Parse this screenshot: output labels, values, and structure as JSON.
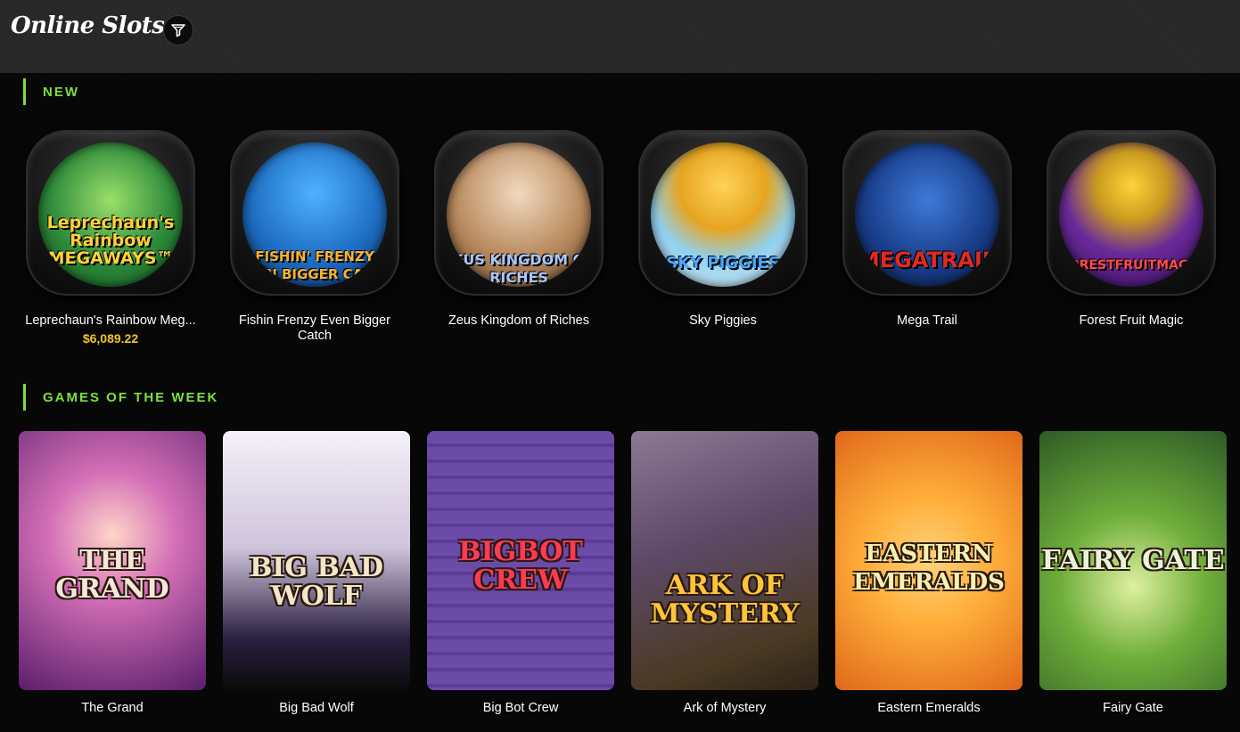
{
  "header": {
    "title": "Online Slots",
    "filter_icon": "filter-funnel-icon"
  },
  "sections": {
    "new": {
      "title": "NEW",
      "games": [
        {
          "title": "Leprechaun's Rainbow Meg...",
          "logo": "Leprechaun's Rainbow MEGAWAYS™",
          "jackpot": "$6,089.22",
          "bg": "#2d8a3a"
        },
        {
          "title": "Fishin Frenzy Even Bigger Catch",
          "logo": "FISHIN' FRENZY EVEN BIGGER CATCH",
          "jackpot": "",
          "bg": "#1f6fc4"
        },
        {
          "title": "Zeus Kingdom of Riches",
          "logo": "ZEUS KINGDOM OF RICHES",
          "jackpot": "",
          "bg": "#b98a5e"
        },
        {
          "title": "Sky Piggies",
          "logo": "SKY PIGGIES",
          "jackpot": "",
          "bg": "#8fd1f0"
        },
        {
          "title": "Mega Trail",
          "logo": "MEGATRAIL",
          "jackpot": "",
          "bg": "#1a3f8c"
        },
        {
          "title": "Forest Fruit Magic",
          "logo": "FORESTFRUITMAGIC",
          "jackpot": "",
          "bg": "#6a2a9a"
        }
      ]
    },
    "games_of_week": {
      "title": "GAMES OF THE WEEK",
      "games": [
        {
          "title": "The Grand",
          "logo": "THE GRAND",
          "bg_top": "#d46fb7",
          "bg_bottom": "#5a1e6b"
        },
        {
          "title": "Big Bad Wolf",
          "logo": "BIG BAD WOLF",
          "bg_top": "#e8e4ee",
          "bg_bottom": "#2a2040"
        },
        {
          "title": "Big Bot Crew",
          "logo": "BIGBOT CREW",
          "bg_top": "#6b4aa8",
          "bg_bottom": "#3a2366"
        },
        {
          "title": "Ark of Mystery",
          "logo": "ARK OF MYSTERY",
          "bg_top": "#6e5a7a",
          "bg_bottom": "#3e2e1c"
        },
        {
          "title": "Eastern Emeralds",
          "logo": "EASTERN EMERALDS",
          "bg_top": "#ffae3a",
          "bg_bottom": "#e0681a"
        },
        {
          "title": "Fairy Gate",
          "logo": "FAIRY GATE",
          "bg_top": "#6fae3a",
          "bg_bottom": "#2e5a26"
        }
      ]
    }
  }
}
